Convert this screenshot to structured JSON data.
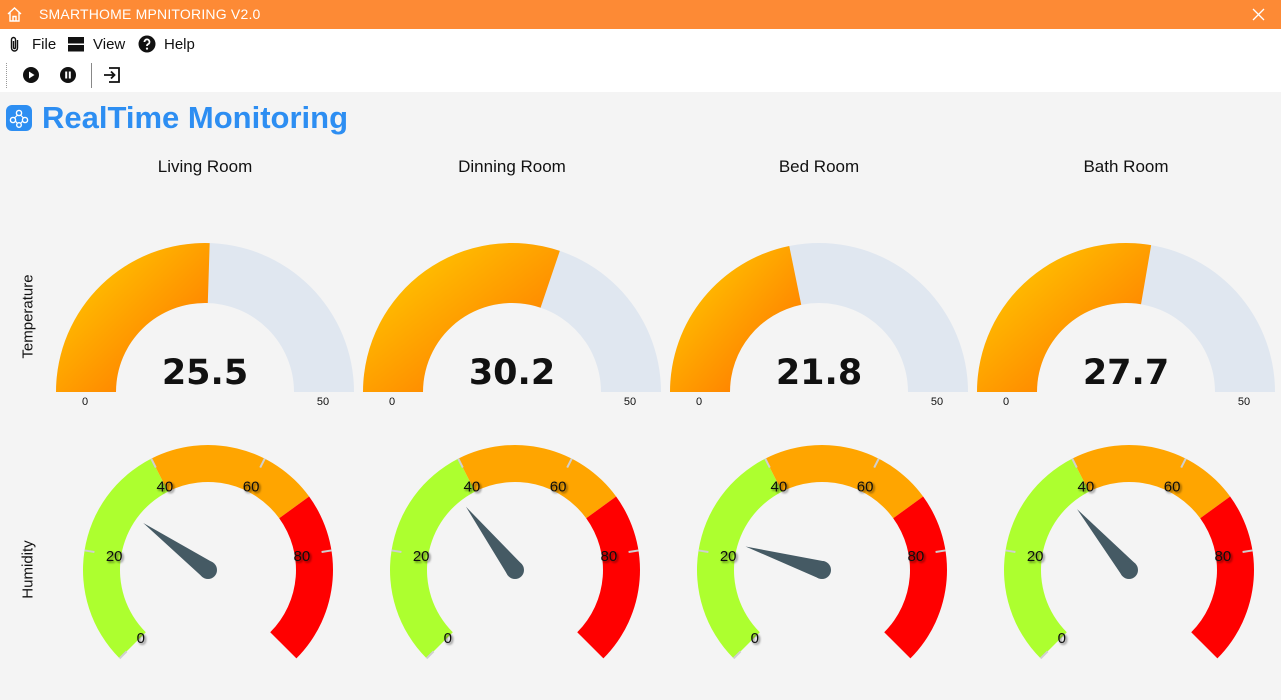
{
  "window": {
    "title": "SMARTHOME MPNITORING V2.0",
    "title_color": "#fd8a35"
  },
  "menu": {
    "items": [
      {
        "label": "File",
        "icon": "paperclip-icon"
      },
      {
        "label": "View",
        "icon": "layout-icon"
      },
      {
        "label": "Help",
        "icon": "help-icon"
      }
    ]
  },
  "toolbar": {
    "buttons": [
      {
        "icon": "play-icon"
      },
      {
        "icon": "pause-icon"
      },
      {
        "icon": "exit-icon"
      }
    ]
  },
  "header": {
    "title": "RealTime Monitoring",
    "icon": "network-icon",
    "color": "#2d8ef2"
  },
  "rows": {
    "temperature_label": "Temperature",
    "humidity_label": "Humidity"
  },
  "rooms": [
    {
      "name": "Living Room",
      "temperature": 25.5,
      "temperature_text": "25.5",
      "humidity": 30
    },
    {
      "name": "Dinning Room",
      "temperature": 30.2,
      "temperature_text": "30.2",
      "humidity": 36
    },
    {
      "name": "Bed Room",
      "temperature": 21.8,
      "temperature_text": "21.8",
      "humidity": 23
    },
    {
      "name": "Bath Room",
      "temperature": 27.7,
      "temperature_text": "27.7",
      "humidity": 35
    }
  ],
  "temperature_gauge": {
    "min": 0,
    "max": 50,
    "min_label": "0",
    "max_label": "50",
    "fill_start_color": "#ffd400",
    "fill_end_color": "#ff6a00",
    "track_color": "#e0e7f0"
  },
  "humidity_gauge": {
    "min": 0,
    "max": 100,
    "tick_labels": [
      "0",
      "20",
      "40",
      "60",
      "80"
    ],
    "bands": [
      {
        "from": 0,
        "to": 40,
        "color": "#adff2f"
      },
      {
        "from": 40,
        "to": 70,
        "color": "#ffa500"
      },
      {
        "from": 70,
        "to": 100,
        "color": "#ff0000"
      }
    ],
    "needle_color": "#455a64"
  }
}
